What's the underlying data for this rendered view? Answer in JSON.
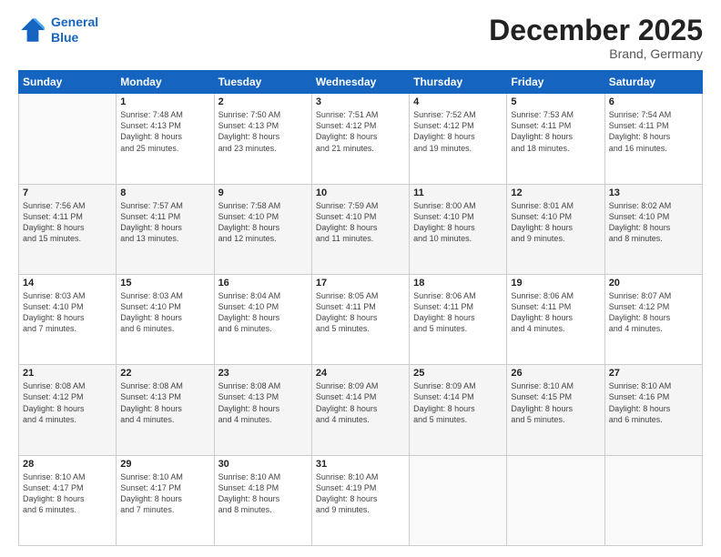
{
  "logo": {
    "line1": "General",
    "line2": "Blue"
  },
  "header": {
    "month": "December 2025",
    "location": "Brand, Germany"
  },
  "days": [
    "Sunday",
    "Monday",
    "Tuesday",
    "Wednesday",
    "Thursday",
    "Friday",
    "Saturday"
  ],
  "weeks": [
    [
      {
        "num": "",
        "info": ""
      },
      {
        "num": "1",
        "info": "Sunrise: 7:48 AM\nSunset: 4:13 PM\nDaylight: 8 hours\nand 25 minutes."
      },
      {
        "num": "2",
        "info": "Sunrise: 7:50 AM\nSunset: 4:13 PM\nDaylight: 8 hours\nand 23 minutes."
      },
      {
        "num": "3",
        "info": "Sunrise: 7:51 AM\nSunset: 4:12 PM\nDaylight: 8 hours\nand 21 minutes."
      },
      {
        "num": "4",
        "info": "Sunrise: 7:52 AM\nSunset: 4:12 PM\nDaylight: 8 hours\nand 19 minutes."
      },
      {
        "num": "5",
        "info": "Sunrise: 7:53 AM\nSunset: 4:11 PM\nDaylight: 8 hours\nand 18 minutes."
      },
      {
        "num": "6",
        "info": "Sunrise: 7:54 AM\nSunset: 4:11 PM\nDaylight: 8 hours\nand 16 minutes."
      }
    ],
    [
      {
        "num": "7",
        "info": "Sunrise: 7:56 AM\nSunset: 4:11 PM\nDaylight: 8 hours\nand 15 minutes."
      },
      {
        "num": "8",
        "info": "Sunrise: 7:57 AM\nSunset: 4:11 PM\nDaylight: 8 hours\nand 13 minutes."
      },
      {
        "num": "9",
        "info": "Sunrise: 7:58 AM\nSunset: 4:10 PM\nDaylight: 8 hours\nand 12 minutes."
      },
      {
        "num": "10",
        "info": "Sunrise: 7:59 AM\nSunset: 4:10 PM\nDaylight: 8 hours\nand 11 minutes."
      },
      {
        "num": "11",
        "info": "Sunrise: 8:00 AM\nSunset: 4:10 PM\nDaylight: 8 hours\nand 10 minutes."
      },
      {
        "num": "12",
        "info": "Sunrise: 8:01 AM\nSunset: 4:10 PM\nDaylight: 8 hours\nand 9 minutes."
      },
      {
        "num": "13",
        "info": "Sunrise: 8:02 AM\nSunset: 4:10 PM\nDaylight: 8 hours\nand 8 minutes."
      }
    ],
    [
      {
        "num": "14",
        "info": "Sunrise: 8:03 AM\nSunset: 4:10 PM\nDaylight: 8 hours\nand 7 minutes."
      },
      {
        "num": "15",
        "info": "Sunrise: 8:03 AM\nSunset: 4:10 PM\nDaylight: 8 hours\nand 6 minutes."
      },
      {
        "num": "16",
        "info": "Sunrise: 8:04 AM\nSunset: 4:10 PM\nDaylight: 8 hours\nand 6 minutes."
      },
      {
        "num": "17",
        "info": "Sunrise: 8:05 AM\nSunset: 4:11 PM\nDaylight: 8 hours\nand 5 minutes."
      },
      {
        "num": "18",
        "info": "Sunrise: 8:06 AM\nSunset: 4:11 PM\nDaylight: 8 hours\nand 5 minutes."
      },
      {
        "num": "19",
        "info": "Sunrise: 8:06 AM\nSunset: 4:11 PM\nDaylight: 8 hours\nand 4 minutes."
      },
      {
        "num": "20",
        "info": "Sunrise: 8:07 AM\nSunset: 4:12 PM\nDaylight: 8 hours\nand 4 minutes."
      }
    ],
    [
      {
        "num": "21",
        "info": "Sunrise: 8:08 AM\nSunset: 4:12 PM\nDaylight: 8 hours\nand 4 minutes."
      },
      {
        "num": "22",
        "info": "Sunrise: 8:08 AM\nSunset: 4:13 PM\nDaylight: 8 hours\nand 4 minutes."
      },
      {
        "num": "23",
        "info": "Sunrise: 8:08 AM\nSunset: 4:13 PM\nDaylight: 8 hours\nand 4 minutes."
      },
      {
        "num": "24",
        "info": "Sunrise: 8:09 AM\nSunset: 4:14 PM\nDaylight: 8 hours\nand 4 minutes."
      },
      {
        "num": "25",
        "info": "Sunrise: 8:09 AM\nSunset: 4:14 PM\nDaylight: 8 hours\nand 5 minutes."
      },
      {
        "num": "26",
        "info": "Sunrise: 8:10 AM\nSunset: 4:15 PM\nDaylight: 8 hours\nand 5 minutes."
      },
      {
        "num": "27",
        "info": "Sunrise: 8:10 AM\nSunset: 4:16 PM\nDaylight: 8 hours\nand 6 minutes."
      }
    ],
    [
      {
        "num": "28",
        "info": "Sunrise: 8:10 AM\nSunset: 4:17 PM\nDaylight: 8 hours\nand 6 minutes."
      },
      {
        "num": "29",
        "info": "Sunrise: 8:10 AM\nSunset: 4:17 PM\nDaylight: 8 hours\nand 7 minutes."
      },
      {
        "num": "30",
        "info": "Sunrise: 8:10 AM\nSunset: 4:18 PM\nDaylight: 8 hours\nand 8 minutes."
      },
      {
        "num": "31",
        "info": "Sunrise: 8:10 AM\nSunset: 4:19 PM\nDaylight: 8 hours\nand 9 minutes."
      },
      {
        "num": "",
        "info": ""
      },
      {
        "num": "",
        "info": ""
      },
      {
        "num": "",
        "info": ""
      }
    ]
  ]
}
